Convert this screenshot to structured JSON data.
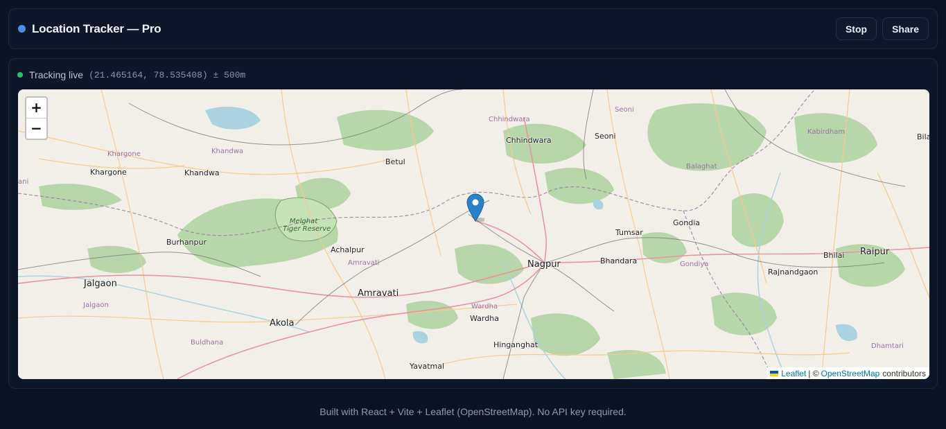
{
  "header": {
    "title": "Location Tracker — Pro",
    "stop_label": "Stop",
    "share_label": "Share"
  },
  "status": {
    "text": "Tracking live",
    "coords": "(21.465164, 78.535408) ± 500m"
  },
  "map": {
    "zoom_in": "+",
    "zoom_out": "−",
    "places": {
      "chhindwara_dist": "Chhindwara",
      "seoni_dist": "Seoni",
      "kabirdham": "Kabirdham",
      "bila": "Bila",
      "khargone_dist": "Khargone",
      "khandwa_dist": "Khandwa",
      "chhindwara": "Chhindwara",
      "seoni": "Seoni",
      "khargone": "Khargone",
      "khandwa": "Khandwa",
      "betul": "Betul",
      "balaghat": "Balaghat",
      "nani": "ani",
      "melghat": "Melghat",
      "tiger_reserve": "Tiger Reserve",
      "tumsar": "Tumsar",
      "gondia": "Gondia",
      "burhanpur": "Burhanpur",
      "achalpur": "Achalpur",
      "bhilai": "Bhilai",
      "raipur": "Raipur",
      "amravati_dist": "Amravati",
      "nagpur": "Nagpur",
      "bhandara": "Bhandara",
      "gondiya_dist": "Gondiya",
      "rajnandgaon": "Rajnandgaon",
      "jalgaon": "Jalgaon",
      "amravati": "Amravati",
      "jalgaon_dist": "Jalgaon",
      "wardha_dist": "Wardha",
      "wardha": "Wardha",
      "akola": "Akola",
      "buldhana_dist": "Buldhana",
      "hinganghat": "Hinganghat",
      "dhamtari_dist": "Dhamtari",
      "yavatmal": "Yavatmal"
    },
    "attribution": {
      "leaflet": "Leaflet",
      "sep": "| ©",
      "osm": "OpenStreetMap",
      "contributors": "contributors"
    }
  },
  "footer": "Built with React + Vite + Leaflet (OpenStreetMap). No API key required.",
  "colors": {
    "accent": "#4d8fe6",
    "live": "#22c55e",
    "marker": "#2a81cb"
  }
}
